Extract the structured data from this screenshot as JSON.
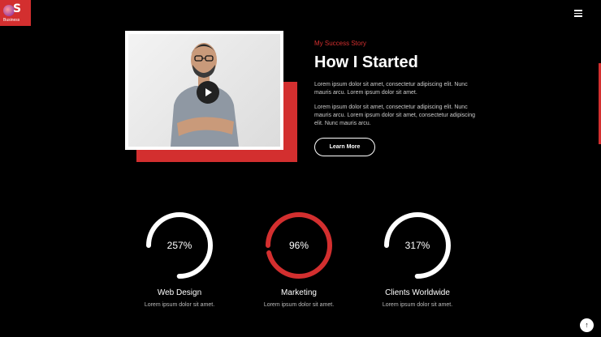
{
  "header": {
    "logo_text": "S",
    "logo_sub": "Business"
  },
  "story": {
    "kicker": "My Success Story",
    "title": "How I Started",
    "paragraph_1": "Lorem ipsum dolor sit amet, consectetur adipiscing elit. Nunc mauris arcu. Lorem ipsum dolor sit amet.",
    "paragraph_2": "Lorem ipsum dolor sit amet, consectetur adipiscing elit. Nunc mauris arcu. Lorem ipsum dolor sit amet, consectetur adipiscing elit. Nunc mauris arcu.",
    "button_label": "Learn More"
  },
  "stats": [
    {
      "value": "257%",
      "name": "Web Design",
      "desc": "Lorem ipsum dolor sit amet.",
      "ring_fraction": 0.75,
      "color": "#ffffff"
    },
    {
      "value": "96%",
      "name": "Marketing",
      "desc": "Lorem ipsum dolor sit amet.",
      "ring_fraction": 0.96,
      "color": "#d32f2f"
    },
    {
      "value": "317%",
      "name": "Clients Worldwide",
      "desc": "Lorem ipsum dolor sit amet.",
      "ring_fraction": 0.75,
      "color": "#ffffff"
    }
  ],
  "colors": {
    "accent": "#d32f2f",
    "background": "#000000"
  },
  "icons": {
    "menu": "hamburger-icon",
    "play": "play-icon",
    "scroll_top": "arrow-up-icon"
  }
}
